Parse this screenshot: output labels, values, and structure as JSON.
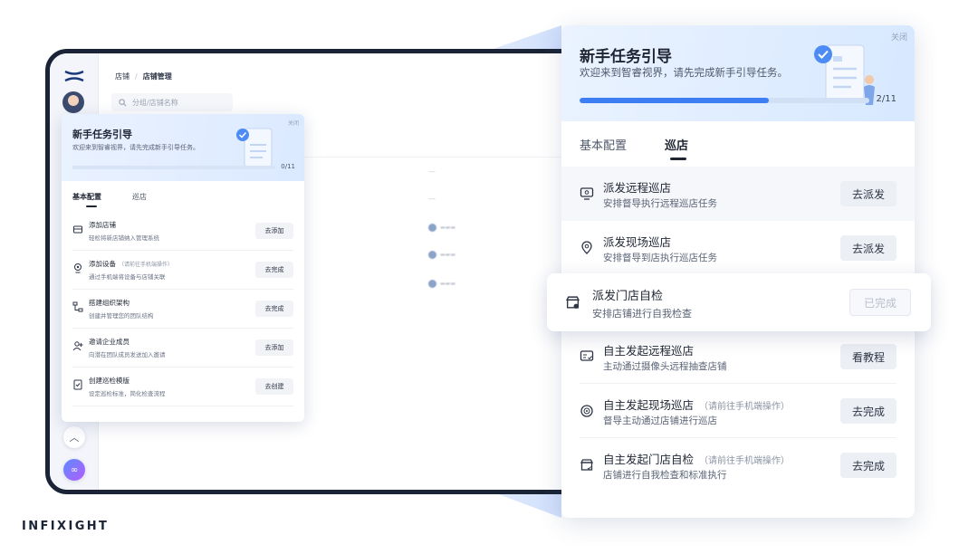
{
  "brand": {
    "name": "INFIXIGHT"
  },
  "background_app": {
    "breadcrumb": [
      "店铺",
      "店铺管理"
    ],
    "search": {
      "placeholder": "分组/店铺名称"
    }
  },
  "small_panel": {
    "close_label": "关闭",
    "title": "新手任务引导",
    "subtitle": "欢迎来到智睿视界，请先完成新手引导任务。",
    "progress": {
      "done": 0,
      "total": 11,
      "label": "0/11"
    },
    "tabs": [
      {
        "label": "基本配置",
        "active": true
      },
      {
        "label": "巡店",
        "active": false
      }
    ],
    "tasks": [
      {
        "icon": "store-icon",
        "title": "添加店铺",
        "hint": "",
        "desc": "轻松将新店铺纳入管理系统",
        "button": "去添加"
      },
      {
        "icon": "camera-icon",
        "title": "添加设备",
        "hint": "（请前往手机端操作）",
        "desc": "通过手机端将设备与店铺关联",
        "button": "去完成"
      },
      {
        "icon": "org-chart-icon",
        "title": "搭建组织架构",
        "hint": "",
        "desc": "创建并管理您的团队结构",
        "button": "去完成"
      },
      {
        "icon": "invite-user-icon",
        "title": "邀请企业成员",
        "hint": "",
        "desc": "向潜在团队成员发送加入邀请",
        "button": "去添加"
      },
      {
        "icon": "checklist-icon",
        "title": "创建巡检模版",
        "hint": "",
        "desc": "设定巡检标准，简化检查流程",
        "button": "去创建"
      }
    ]
  },
  "large_panel": {
    "close_label": "关闭",
    "title": "新手任务引导",
    "subtitle": "欢迎来到智睿视界，请先完成新手引导任务。",
    "progress": {
      "done": 2,
      "total": 11,
      "label": "2/11"
    },
    "tabs": [
      {
        "label": "基本配置",
        "active": false
      },
      {
        "label": "巡店",
        "active": true
      }
    ],
    "tasks": [
      {
        "icon": "remote-monitor-icon",
        "title": "派发远程巡店",
        "hint": "",
        "desc": "安排督导执行远程巡店任务",
        "button": "去派发",
        "state": "hover"
      },
      {
        "icon": "location-pin-icon",
        "title": "派发现场巡店",
        "hint": "",
        "desc": "安排督导到店执行巡店任务",
        "button": "去派发",
        "state": "normal"
      },
      {
        "icon": "store-check-icon",
        "title": "派发门店自检",
        "hint": "",
        "desc": "安排店铺进行自我检查",
        "button": "已完成",
        "state": "done"
      },
      {
        "icon": "screen-check-icon",
        "title": "自主发起远程巡店",
        "hint": "",
        "desc": "主动通过摄像头远程抽查店铺",
        "button": "看教程",
        "state": "normal"
      },
      {
        "icon": "target-icon",
        "title": "自主发起现场巡店",
        "hint": "（请前往手机端操作）",
        "desc": "督导主动通过店铺进行巡店",
        "button": "去完成",
        "state": "normal"
      },
      {
        "icon": "store-self-check-icon",
        "title": "自主发起门店自检",
        "hint": "（请前往手机端操作）",
        "desc": "店铺进行自我检查和标准执行",
        "button": "去完成",
        "state": "normal"
      }
    ]
  },
  "colors": {
    "accent": "#3d7ef2",
    "header_bg": "#dbe9ff",
    "frame": "#1b2436"
  }
}
